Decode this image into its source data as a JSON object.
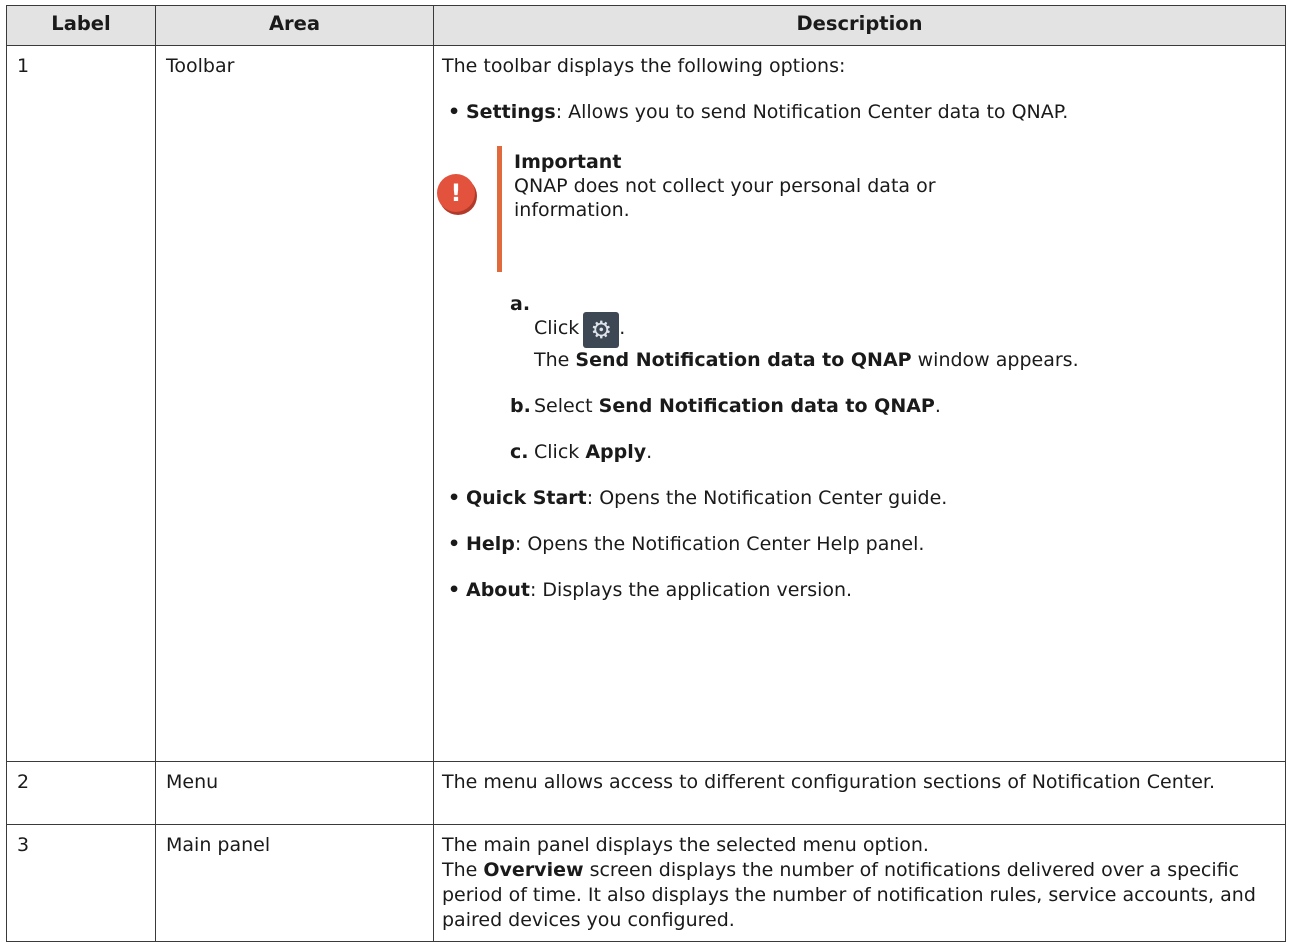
{
  "headers": {
    "label": "Label",
    "area": "Area",
    "description": "Description"
  },
  "row1": {
    "label": "1",
    "area": "Toolbar",
    "intro": "The toolbar displays the following options:",
    "settings": {
      "term": "Settings",
      "text": ": Allows you to send Notification Center data to QNAP."
    },
    "important": {
      "icon": "exclamation-icon",
      "title": "Important",
      "text": "QNAP does not collect your personal data or information."
    },
    "steps": {
      "a": {
        "marker": "a.",
        "click": "Click",
        "period": ".",
        "icon": "gear-settings-icon",
        "line2_pre": "The ",
        "line2_bold": "Send Notification data to QNAP",
        "line2_post": " window appears."
      },
      "b": {
        "marker": "b.",
        "pre": "Select ",
        "bold": "Send Notification data to QNAP",
        "post": "."
      },
      "c": {
        "marker": "c.",
        "pre": "Click ",
        "bold": "Apply",
        "post": "."
      }
    },
    "quick_start": {
      "term": "Quick Start",
      "text": ": Opens the Notification Center guide."
    },
    "help": {
      "term": "Help",
      "text": ": Opens the Notification Center Help panel."
    },
    "about": {
      "term": "About",
      "text": ": Displays the application version."
    },
    "bullet": "•"
  },
  "row2": {
    "label": "2",
    "area": "Menu",
    "description": "The menu allows access to different configuration sections of Notification Center."
  },
  "row3": {
    "label": "3",
    "area": "Main panel",
    "line1": "The main panel displays the selected menu option.",
    "pre": "The ",
    "bold": "Overview",
    "post": " screen displays the number of notifications delivered over a specific period of time. It also displays the number of notification rules, service accounts, and paired devices you configured."
  }
}
